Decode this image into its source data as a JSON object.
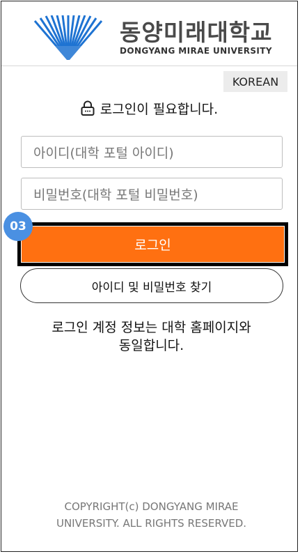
{
  "header": {
    "logo_korean": "동양미래대학교",
    "logo_english": "DONGYANG MIRAE UNIVERSITY"
  },
  "language_button": "KOREAN",
  "notice": {
    "icon": "lock-icon",
    "text": "로그인이 필요합니다."
  },
  "form": {
    "id_placeholder": "아이디(대학 포털 아이디)",
    "password_placeholder": "비밀번호(대학 포털 비밀번호)",
    "login_label": "로그인",
    "find_label": "아이디 및 비밀번호 찾기"
  },
  "step_badge": "03",
  "info": {
    "line1": "로그인 계정 정보는 대학 홈페이지와",
    "line2": "동일합니다."
  },
  "footer": {
    "line1": "COPYRIGHT(c) DONGYANG MIRAE",
    "line2": "UNIVERSITY. ALL RIGHTS RESERVED."
  },
  "colors": {
    "accent": "#ff7011",
    "logo_blue": "#1e73d2",
    "badge": "#4a90e2",
    "highlight": "#000000"
  }
}
